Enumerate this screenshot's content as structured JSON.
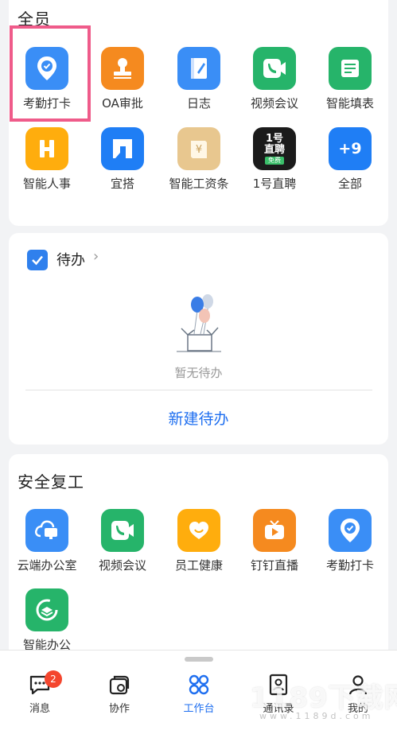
{
  "section_all": {
    "title": "全员",
    "apps": [
      {
        "label": "考勤打卡",
        "icon": "attendance-icon"
      },
      {
        "label": "OA审批",
        "icon": "approval-stamp-icon"
      },
      {
        "label": "日志",
        "icon": "log-icon"
      },
      {
        "label": "视频会议",
        "icon": "video-meeting-icon"
      },
      {
        "label": "智能填表",
        "icon": "form-icon"
      },
      {
        "label": "智能人事",
        "icon": "hr-icon"
      },
      {
        "label": "宜搭",
        "icon": "yida-icon"
      },
      {
        "label": "智能工资条",
        "icon": "payslip-icon"
      },
      {
        "label": "1号直聘",
        "icon": "recruit-icon",
        "icon_text": [
          "1号",
          "直聘",
          "免费"
        ]
      },
      {
        "label": "全部",
        "icon": "more-icon",
        "icon_text": "+9"
      }
    ]
  },
  "todo": {
    "title": "待办",
    "empty_text": "暂无待办",
    "new_label": "新建待办"
  },
  "section_safe": {
    "title": "安全复工",
    "apps": [
      {
        "label": "云端办公室",
        "icon": "cloud-office-icon"
      },
      {
        "label": "视频会议",
        "icon": "video-meeting-icon"
      },
      {
        "label": "员工健康",
        "icon": "health-icon"
      },
      {
        "label": "钉钉直播",
        "icon": "live-icon"
      },
      {
        "label": "考勤打卡",
        "icon": "attendance-icon"
      },
      {
        "label": "智能办公",
        "icon": "smart-office-icon"
      }
    ]
  },
  "bottom_nav": {
    "items": [
      {
        "label": "消息",
        "icon": "message-icon",
        "badge": "2"
      },
      {
        "label": "协作",
        "icon": "collab-icon"
      },
      {
        "label": "工作台",
        "icon": "workbench-icon",
        "active": true
      },
      {
        "label": "通讯录",
        "icon": "contacts-icon"
      },
      {
        "label": "我的",
        "icon": "profile-icon"
      }
    ]
  },
  "watermark": {
    "text": "1189下载网",
    "sub": "www.1189d.com"
  },
  "colors": {
    "accent": "#1f6ff0",
    "highlight": "#ef5b8a",
    "badge": "#f4462e"
  }
}
